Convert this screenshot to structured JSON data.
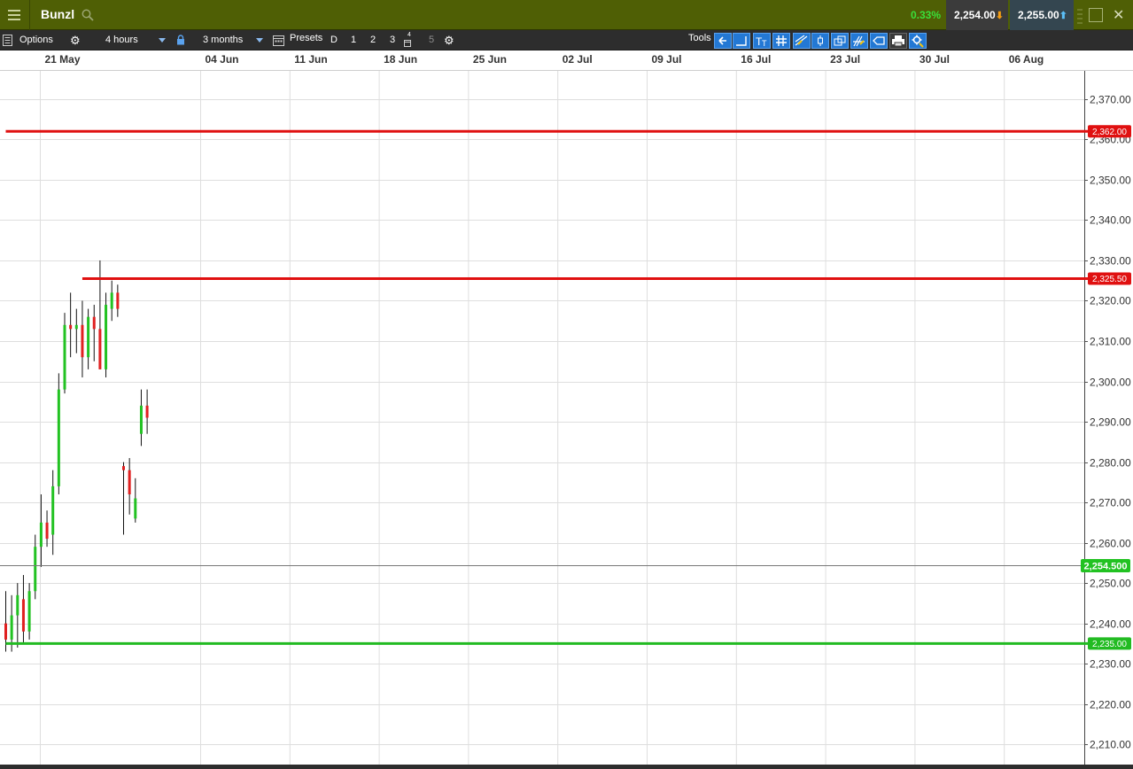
{
  "header": {
    "instrument": "Bunzl",
    "change_pct": "0.33%",
    "sell_price": "2,254.00",
    "buy_price": "2,255.00",
    "colors": {
      "bar": "#4f5f05",
      "change_positive": "#3adf3a"
    }
  },
  "toolbar": {
    "options_label": "Options",
    "interval_label": "4 hours",
    "range_label": "3 months",
    "presets_label": "Presets",
    "preset_buttons": [
      "D",
      "1",
      "2",
      "3",
      "4",
      "5"
    ],
    "tools_label": "Tools",
    "icons": [
      "options-list-icon",
      "gear-icon",
      "lock-icon",
      "calendar-icon",
      "back-arrow-icon",
      "curve-line-icon",
      "text-tool-icon",
      "grid-tool-icon",
      "trend-line-icon",
      "candle-icon",
      "layers-icon",
      "fibonacci-icon",
      "label-tag-icon",
      "print-icon",
      "settings-tool-icon"
    ]
  },
  "chart_data": {
    "type": "candlestick",
    "title": "",
    "x_ticks": [
      "21 May",
      "04 Jun",
      "11 Jun",
      "18 Jun",
      "25 Jun",
      "02 Jul",
      "09 Jul",
      "16 Jul",
      "23 Jul",
      "30 Jul",
      "06 Aug"
    ],
    "y_ticks": [
      "2,370.00",
      "2,360.00",
      "2,350.00",
      "2,340.00",
      "2,330.00",
      "2,320.00",
      "2,310.00",
      "2,300.00",
      "2,290.00",
      "2,280.00",
      "2,270.00",
      "2,260.00",
      "2,250.00",
      "2,240.00",
      "2,230.00",
      "2,220.00",
      "2,210.00"
    ],
    "ylim": [
      2205,
      2377
    ],
    "grid": true,
    "colors": {
      "up": "#22c222",
      "down": "#e02020",
      "resistance": "#e01010",
      "support": "#22bb22"
    },
    "levels": [
      {
        "value": 2362,
        "label": "2,362.00",
        "kind": "resistance",
        "start": 0
      },
      {
        "value": 2325.5,
        "label": "2,325.50",
        "kind": "resistance",
        "start": 13
      },
      {
        "value": 2235,
        "label": "2,235.00",
        "kind": "support",
        "start": 0
      }
    ],
    "current_price": {
      "value": 2254.5,
      "label": "2,254.500"
    },
    "candles": [
      [
        2240,
        2248,
        2233,
        2236
      ],
      [
        2236,
        2247,
        2233,
        2242
      ],
      [
        2242,
        2250,
        2234,
        2247
      ],
      [
        2246,
        2252,
        2235,
        2238
      ],
      [
        2238,
        2250,
        2236,
        2248
      ],
      [
        2248,
        2262,
        2246,
        2259
      ],
      [
        2259,
        2272,
        2254,
        2265
      ],
      [
        2265,
        2268,
        2259,
        2261
      ],
      [
        2262,
        2278,
        2257,
        2274
      ],
      [
        2274,
        2302,
        2272,
        2298
      ],
      [
        2298,
        2317,
        2297,
        2314
      ],
      [
        2314,
        2322,
        2306,
        2313
      ],
      [
        2313,
        2318,
        2307,
        2314
      ],
      [
        2314,
        2320,
        2301,
        2306
      ],
      [
        2306,
        2318,
        2303,
        2316
      ],
      [
        2316,
        2319,
        2305,
        2313
      ],
      [
        2313,
        2330,
        2303,
        2303
      ],
      [
        2303,
        2322,
        2301,
        2319
      ],
      [
        2318,
        2325,
        2315,
        2322
      ],
      [
        2322,
        2324,
        2316,
        2318
      ],
      [
        2279,
        2280,
        2262,
        2278
      ],
      [
        2278,
        2281,
        2267,
        2272
      ],
      [
        2266,
        2276,
        2265,
        2271
      ],
      [
        2287,
        2298,
        2284,
        2294
      ],
      [
        2294,
        2298,
        2287,
        2291
      ]
    ]
  }
}
